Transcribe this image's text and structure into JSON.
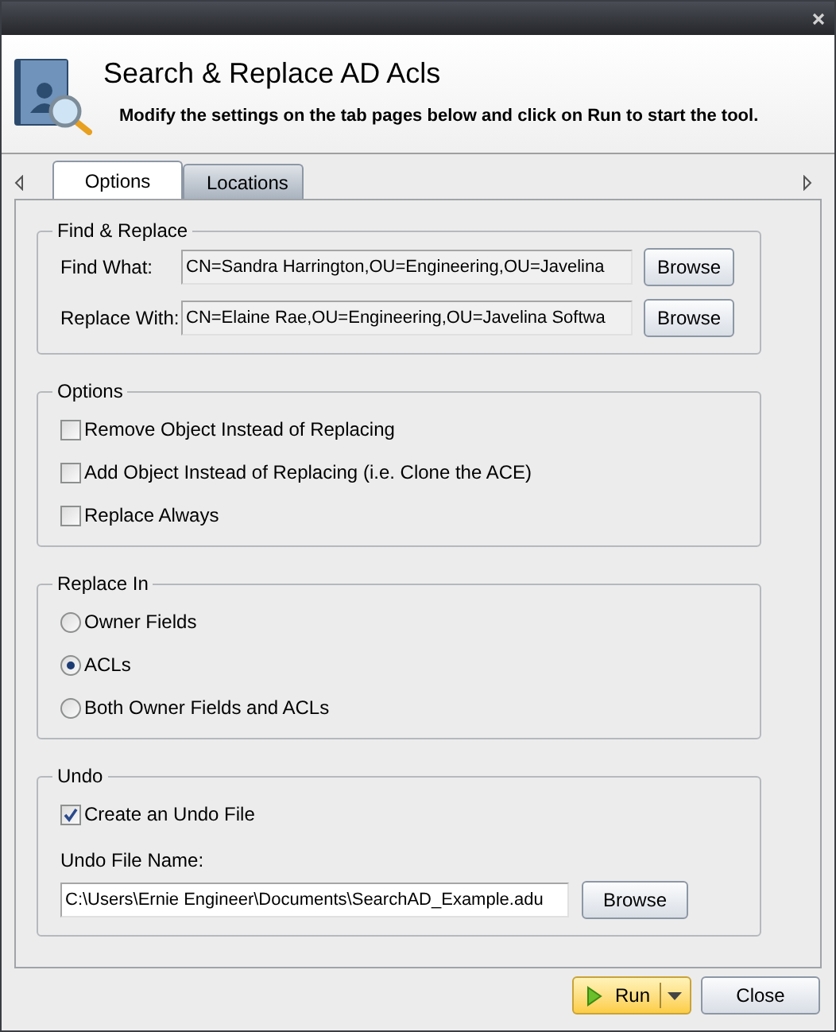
{
  "header": {
    "title": "Search & Replace AD Acls",
    "subtitle": "Modify the settings on the tab pages below and click on Run to start the tool."
  },
  "tabs": [
    {
      "label": "Options",
      "selected": true
    },
    {
      "label": "Locations",
      "selected": false
    }
  ],
  "find_replace": {
    "title": "Find & Replace",
    "rows": [
      {
        "label": "Find What:",
        "value": "CN=Sandra Harrington,OU=Engineering,OU=Javelina",
        "button": "Browse"
      },
      {
        "label": "Replace With:",
        "value": "CN=Elaine Rae,OU=Engineering,OU=Javelina Softwa",
        "button": "Browse"
      }
    ]
  },
  "options": {
    "title": "Options",
    "items": [
      {
        "label": "Remove Object Instead of Replacing",
        "checked": false
      },
      {
        "label": "Add Object Instead of Replacing (i.e. Clone the ACE)",
        "checked": false
      },
      {
        "label": "Replace Always",
        "checked": false
      }
    ]
  },
  "replace_in": {
    "title": "Replace In",
    "items": [
      {
        "label": "Owner Fields",
        "selected": false
      },
      {
        "label": "ACLs",
        "selected": true
      },
      {
        "label": "Both Owner Fields and ACLs",
        "selected": false
      }
    ]
  },
  "undo": {
    "title": "Undo",
    "create": {
      "label": "Create an Undo File",
      "checked": true
    },
    "file_label": "Undo File Name:",
    "file_value": "C:\\Users\\Ernie Engineer\\Documents\\SearchAD_Example.adu",
    "button": "Browse"
  },
  "buttons": {
    "run": "Run",
    "close": "Close"
  }
}
